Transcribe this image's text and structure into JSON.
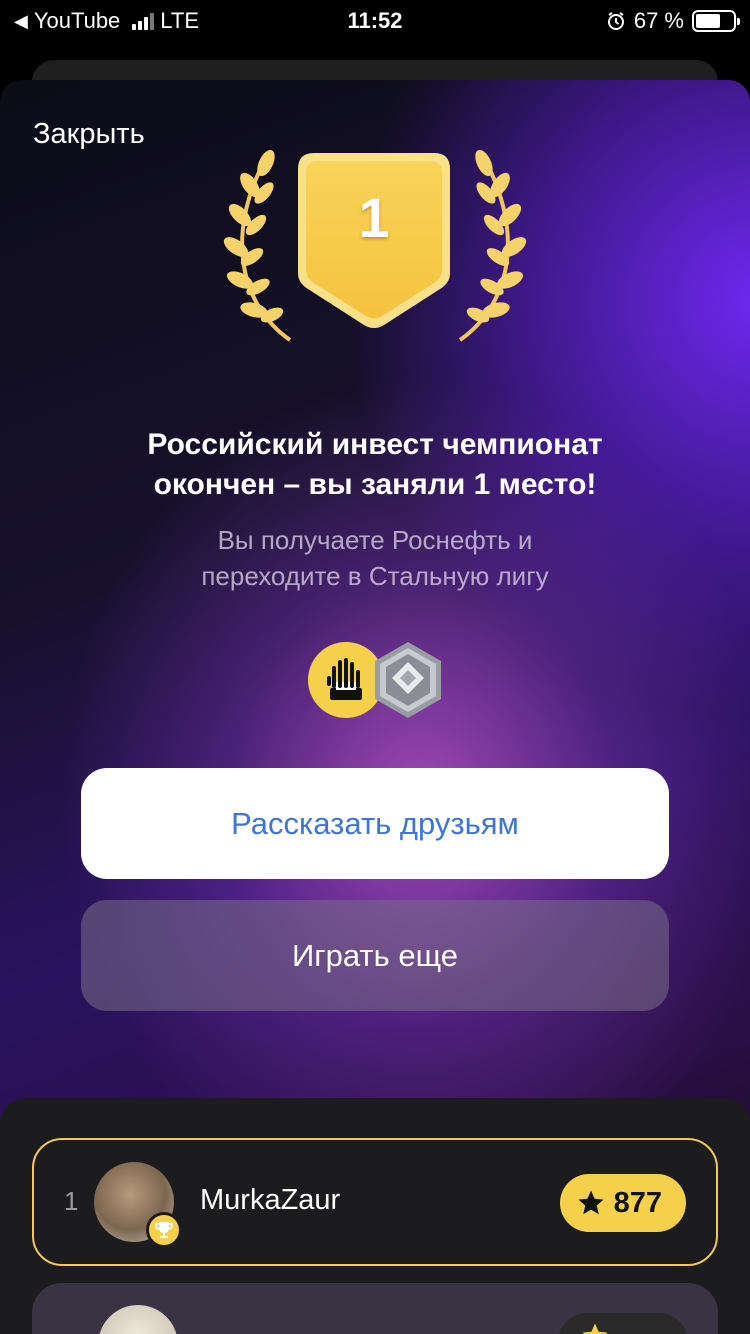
{
  "status_bar": {
    "back_app": "YouTube",
    "network": "LTE",
    "time": "11:52",
    "battery_text": "67 %",
    "battery_level": 0.67
  },
  "sheet": {
    "close_label": "Закрыть",
    "place_number": "1",
    "headline_line1": "Российский инвест чемпионат",
    "headline_line2": "окончен – вы заняли 1 место!",
    "subtext_line1": "Вы получаете Роснефть и",
    "subtext_line2": "переходите в Стальную лигу",
    "reward_icons": [
      "rosneft-icon",
      "steel-league-icon"
    ],
    "share_button": "Рассказать друзьям",
    "play_again_button": "Играть еще"
  },
  "leaderboard": {
    "rows": [
      {
        "rank": "1",
        "name": "MurkaZaur",
        "score": "877"
      }
    ]
  },
  "colors": {
    "accent_gold": "#f5d04a",
    "share_text": "#3f74d9",
    "purple": "#6a28e8"
  }
}
